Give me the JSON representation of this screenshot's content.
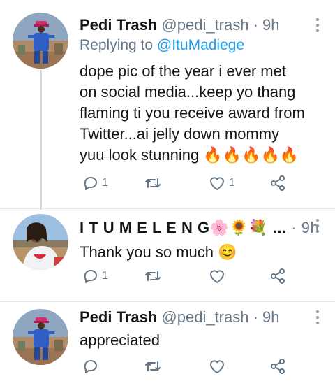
{
  "tweets": [
    {
      "display_name": "Pedi Trash",
      "handle": "@pedi_trash",
      "time_sep": " · ",
      "time": "9h",
      "replying_prefix": "Replying to ",
      "replying_to": "@ItuMadiege",
      "text": "dope pic of the year i ever met on social media...keep yo thang flaming ti you receive award from Twitter...ai jelly down mommy yuu look stunning 🔥🔥🔥🔥🔥",
      "reply_count": "1",
      "retweet_count": "",
      "like_count": "1"
    },
    {
      "display_name": "I T U M E L E N G🌸🌻💐 ...",
      "time_sep": " · ",
      "time": "9h",
      "text": "Thank you so much 😊",
      "reply_count": "1",
      "retweet_count": "",
      "like_count": ""
    },
    {
      "display_name": "Pedi Trash",
      "handle": "@pedi_trash",
      "time_sep": " · ",
      "time": "9h",
      "text": "appreciated",
      "reply_count": "",
      "retweet_count": "",
      "like_count": ""
    }
  ],
  "icons": {
    "reply": "reply-icon",
    "retweet": "retweet-icon",
    "like": "heart-icon",
    "share": "share-icon",
    "more": "more-vertical-icon"
  },
  "colors": {
    "name": "#14171a",
    "secondary": "#657786",
    "mention": "#1da1f2",
    "icon": "#657786",
    "thread_line": "#cfd9de"
  }
}
